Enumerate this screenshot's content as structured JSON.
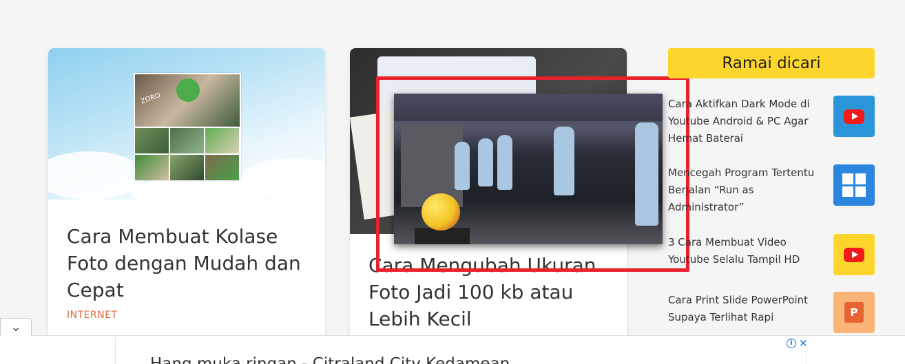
{
  "cards": [
    {
      "title": "Cara Membuat Kolase Foto dengan Mudah dan Cepat",
      "category": "INTERNET",
      "thumbnail_text": "ZORO"
    },
    {
      "title": "Cara Mengubah Ukuran Foto Jadi 100 kb atau Lebih Kecil"
    }
  ],
  "sidebar": {
    "heading": "Ramai dicari",
    "items": [
      {
        "label": "Cara Aktifkan Dark Mode di Youtube Android & PC Agar Hemat Baterai",
        "icon": "youtube-icon",
        "bg": "#2b95d9"
      },
      {
        "label": "Mencegah Program Tertentu Berjalan “Run as Administrator”",
        "icon": "windows-icon",
        "bg": "#2b86e0"
      },
      {
        "label": "3 Cara Membuat Video Youtube Selalu Tampil HD",
        "icon": "youtube-icon",
        "bg": "#fdd52d"
      },
      {
        "label": "Cara Print Slide PowerPoint Supaya Terlihat Rapi",
        "icon": "powerpoint-icon",
        "bg": "#fbb478"
      }
    ]
  },
  "ad": {
    "text": "Hang muka ringan - Citraland City Kedamean",
    "info_glyph": "i",
    "close_glyph": "✕"
  },
  "ui": {
    "collapse_glyph": "⌄",
    "ppt_letter": "P"
  },
  "colors": {
    "accent": "#fdd52d",
    "category": "#e0683a",
    "highlight_frame": "#e8212b"
  }
}
